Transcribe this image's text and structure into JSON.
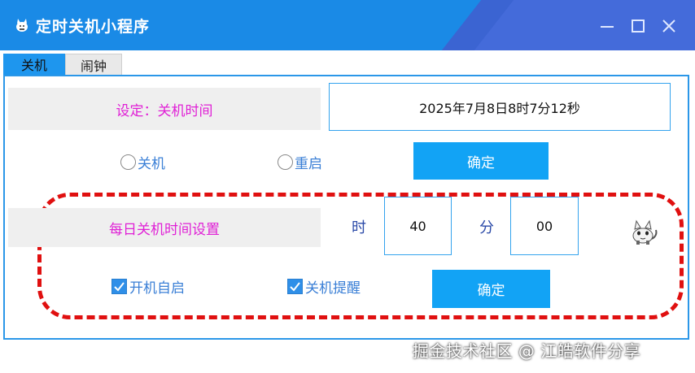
{
  "window": {
    "title": "定时关机小程序",
    "accent": "#1a8ae6"
  },
  "tabs": [
    {
      "label": "关机",
      "selected": true
    },
    {
      "label": "闹钟",
      "selected": false
    }
  ],
  "shutdown_section": {
    "label": "设定：关机时间",
    "time_value": "2025年7月8日8时7分12秒",
    "radio_shutdown": "关机",
    "radio_restart": "重启",
    "confirm_label": "确定"
  },
  "daily_section": {
    "label": "每日关机时间设置",
    "hour_unit": "时",
    "hour_value": "40",
    "minute_unit": "分",
    "minute_value": "00",
    "autostart_label": "开机自启",
    "autostart_checked": true,
    "remind_label": "关机提醒",
    "remind_checked": true,
    "confirm_label": "确定"
  },
  "icons": {
    "app": "cat-icon",
    "mascot": "cat-icon"
  },
  "colors": {
    "label_text": "#e020d6",
    "button_bg": "#12a3f5",
    "highlight_frame": "#e01010"
  },
  "watermark": "掘金技术社区 @ 江皓软件分享"
}
